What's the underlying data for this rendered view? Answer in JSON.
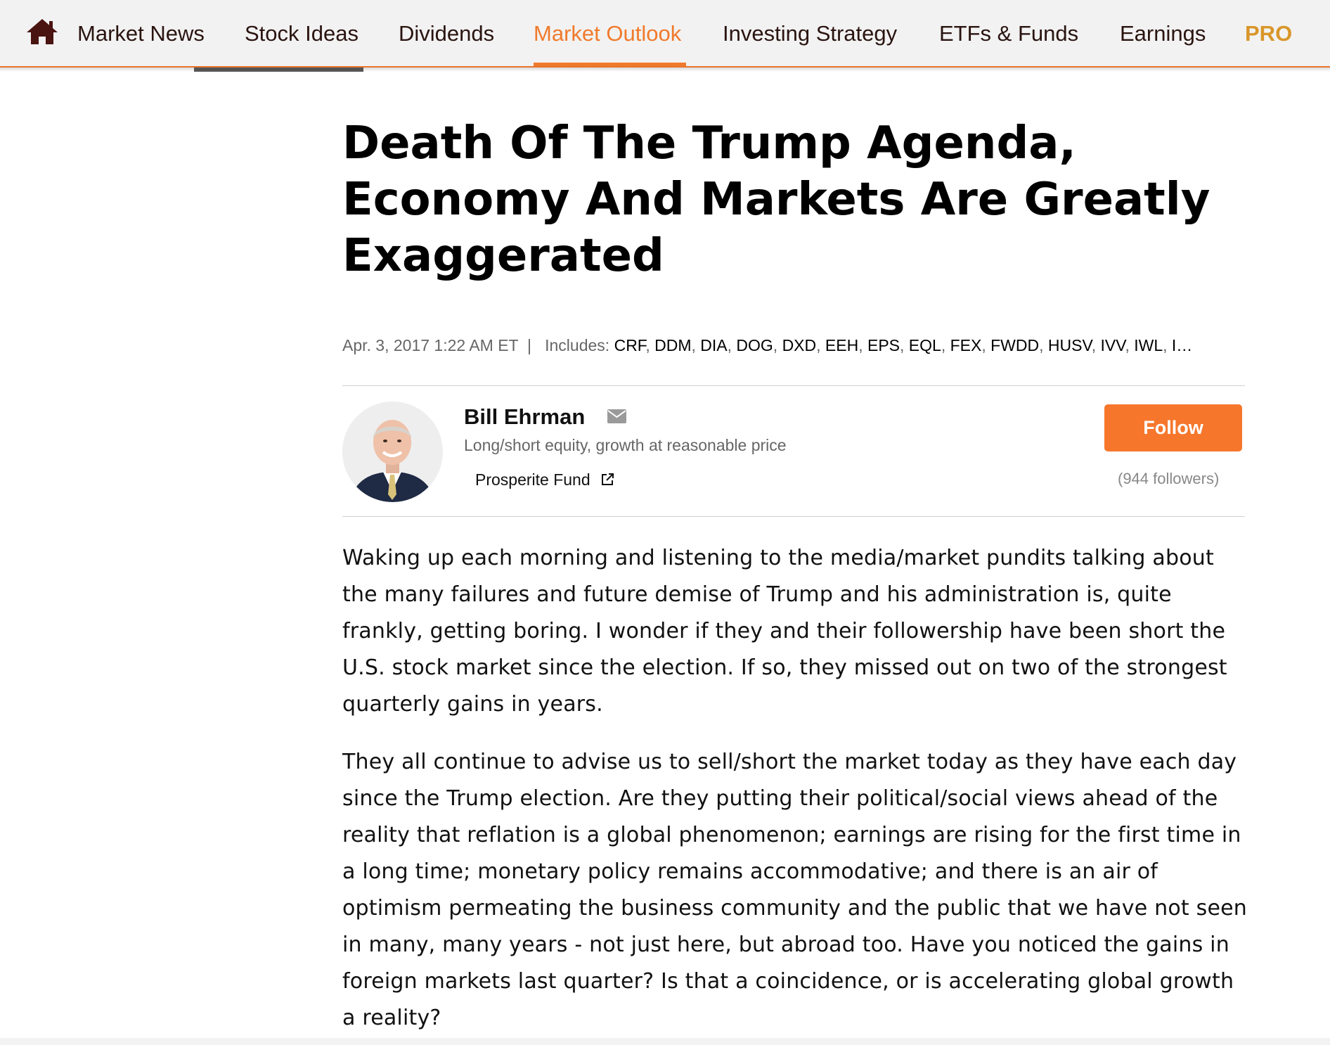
{
  "nav": {
    "home_icon": "home-icon",
    "items": [
      {
        "label": "Market News"
      },
      {
        "label": "Stock Ideas"
      },
      {
        "label": "Dividends"
      },
      {
        "label": "Market Outlook"
      },
      {
        "label": "Investing Strategy"
      },
      {
        "label": "ETFs & Funds"
      },
      {
        "label": "Earnings"
      },
      {
        "label": "PRO"
      }
    ],
    "active_item": "Market Outlook",
    "accent_color": "#f07a2c",
    "pro_color": "#d9962a"
  },
  "article": {
    "title": "Death Of The Trump Agenda, Economy And Markets Are Greatly Exaggerated",
    "date": "Apr. 3, 2017 1:22 AM ET",
    "includes_label": "Includes:",
    "tickers": [
      "CRF",
      "DDM",
      "DIA",
      "DOG",
      "DXD",
      "EEH",
      "EPS",
      "EQL",
      "FEX",
      "FWDD",
      "HUSV",
      "IVV",
      "IWL"
    ],
    "tickers_overflow": "I…",
    "paragraphs": [
      "Waking up each morning and listening to the media/market pundits talking about the many failures and future demise of Trump and his administration is, quite frankly, getting boring. I wonder if they and their followership have been short the U.S. stock market since the election. If so, they missed out on two of the strongest quarterly gains in years.",
      "They all continue to advise us to sell/short the market today as they have each day since the Trump election. Are they putting their political/social views ahead of the reality that reflation is a global phenomenon; earnings are rising for the first time in a long time; monetary policy remains accommodative; and there is an air of optimism permeating the business community and the public that we have not seen in many, many years - not just here, but abroad too. Have you noticed the gains in foreign markets last quarter? Is that a coincidence, or is accelerating global growth a reality?"
    ]
  },
  "author": {
    "name": "Bill Ehrman",
    "bio": "Long/short equity, growth at reasonable price",
    "fund": "Prosperite Fund",
    "follow_label": "Follow",
    "followers": "(944 followers)",
    "follow_color": "#f6772c"
  }
}
